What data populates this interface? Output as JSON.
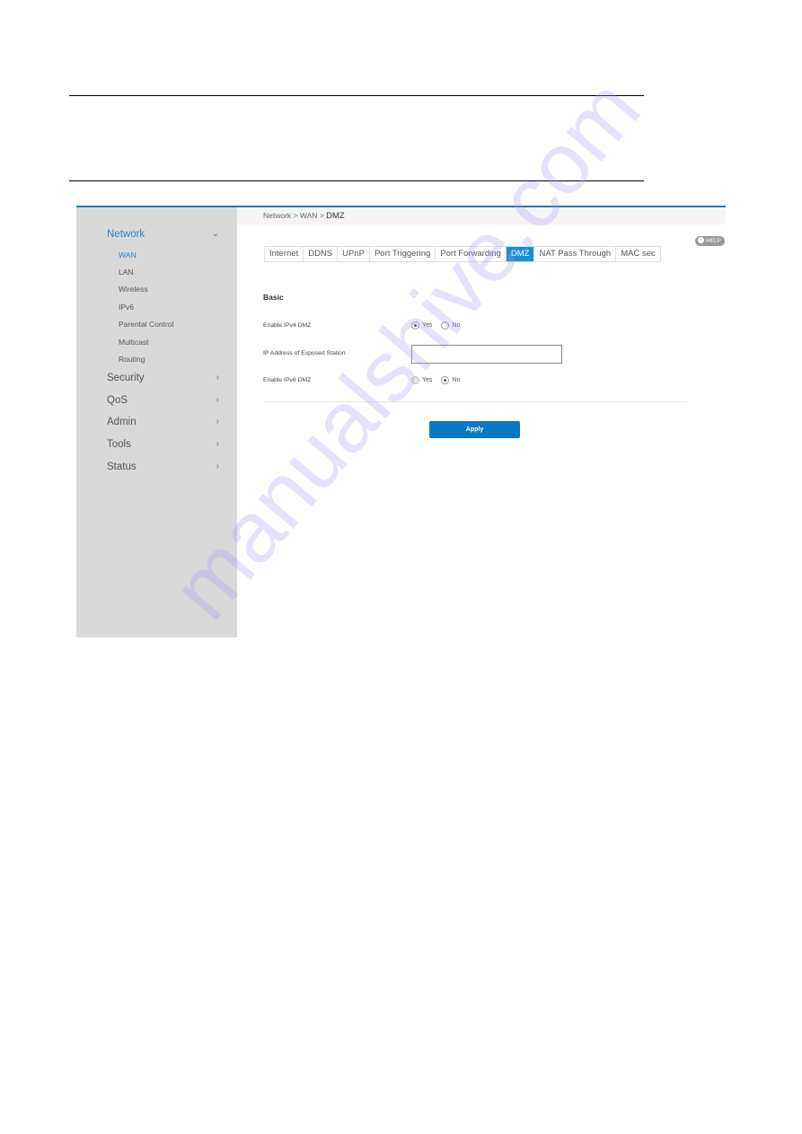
{
  "breadcrumb": {
    "items": [
      "Network",
      "WAN"
    ],
    "separator": " > ",
    "current": "DMZ"
  },
  "sidebar": {
    "sections": [
      {
        "label": "Network",
        "expanded": true,
        "active": true,
        "icon": "chevron-down-icon",
        "items": [
          {
            "label": "WAN",
            "active": true
          },
          {
            "label": "LAN"
          },
          {
            "label": "Wireless"
          },
          {
            "label": "IPv6"
          },
          {
            "label": "Parental Control"
          },
          {
            "label": "Multicast"
          },
          {
            "label": "Routing"
          }
        ]
      },
      {
        "label": "Security",
        "icon": "chevron-right-icon"
      },
      {
        "label": "QoS",
        "icon": "chevron-right-icon"
      },
      {
        "label": "Admin",
        "icon": "chevron-right-icon"
      },
      {
        "label": "Tools",
        "icon": "chevron-right-icon"
      },
      {
        "label": "Status",
        "icon": "chevron-right-icon"
      }
    ]
  },
  "tabs": [
    {
      "label": "Internet"
    },
    {
      "label": "DDNS"
    },
    {
      "label": "UPnP"
    },
    {
      "label": "Port Triggering"
    },
    {
      "label": "Port Forwarding"
    },
    {
      "label": "DMZ",
      "active": true
    },
    {
      "label": "NAT Pass Through"
    },
    {
      "label": "MAC sec"
    }
  ],
  "help": {
    "label": "HELP",
    "icon": "chevron-left-circle-icon"
  },
  "form": {
    "section_title": "Basic",
    "ipv4_dmz": {
      "label": "Enable IPv4 DMZ",
      "options": [
        "Yes",
        "No"
      ],
      "selected": "Yes"
    },
    "ip_address": {
      "label": "IP Address of Exposed Station",
      "value": "",
      "placeholder": ""
    },
    "ipv6_dmz": {
      "label": "Enable IPv6 DMZ",
      "options": [
        "Yes",
        "No"
      ],
      "selected": "No",
      "disabled_option": "Yes"
    },
    "apply_label": "Apply"
  },
  "colors": {
    "accent": "#1a8fd8",
    "apply_button": "#0a78c3",
    "sidebar_bg": "#d9d9d9",
    "active_nav": "#2d7fd0"
  },
  "watermark": "manualshive.com"
}
